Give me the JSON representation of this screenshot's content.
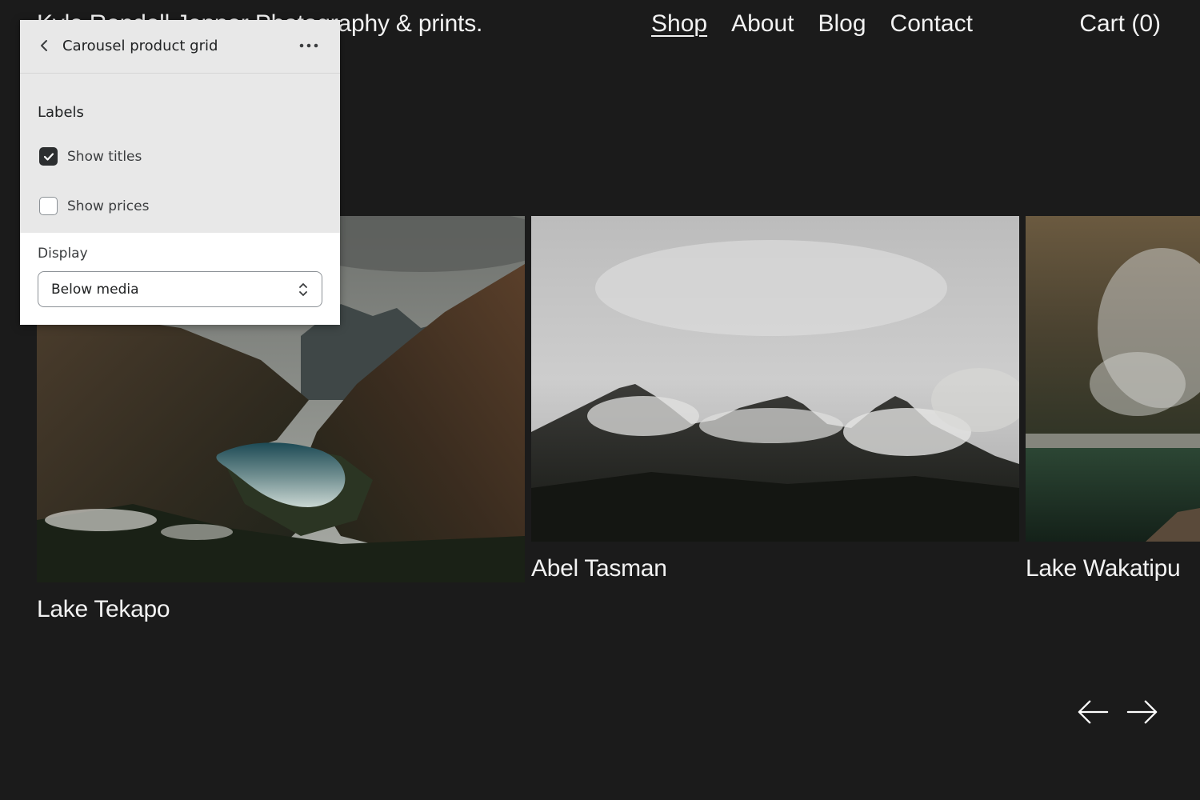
{
  "site": {
    "title": "Kyle Rendell Jenner Photography & prints.",
    "cart_label": "Cart (0)"
  },
  "nav": {
    "items": [
      {
        "label": "Shop",
        "active": true
      },
      {
        "label": "About",
        "active": false
      },
      {
        "label": "Blog",
        "active": false
      },
      {
        "label": "Contact",
        "active": false
      }
    ]
  },
  "products": [
    {
      "title": "Lake Tekapo",
      "image": "mountain-valley-lake-image"
    },
    {
      "title": "Abel Tasman",
      "image": "misty-mountain-peaks-image"
    },
    {
      "title": "Lake Wakatipu",
      "image": "mountain-lake-mist-image"
    }
  ],
  "carousel": {
    "prev_icon": "arrow-left-icon",
    "next_icon": "arrow-right-icon"
  },
  "editor": {
    "title": "Carousel product grid",
    "back_icon": "chevron-left-icon",
    "more_icon": "more-horizontal-icon",
    "labels_heading": "Labels",
    "show_titles": {
      "label": "Show titles",
      "checked": true
    },
    "show_prices": {
      "label": "Show prices",
      "checked": false
    },
    "display_label": "Display",
    "display_value": "Below media"
  },
  "colors": {
    "background": "#1b1b1b",
    "text": "#f2f2f2",
    "panel_gray": "#e8e8e8",
    "checkbox_dark": "#2c2e30"
  }
}
